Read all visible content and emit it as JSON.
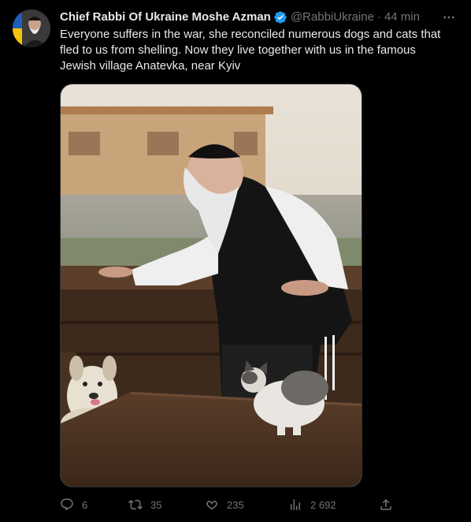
{
  "author": {
    "display_name": "Chief Rabbi Of Ukraine Moshe Azman",
    "handle": "@RabbiUkraine",
    "separator": "·",
    "time": "44 min",
    "verified": true
  },
  "tweet": {
    "text": "Everyone suffers in the war, she reconciled numerous dogs and cats that fled to us from shelling. Now they live together with us in the famous Jewish village Anatevka, near Kyiv"
  },
  "actions": {
    "replies": "6",
    "reposts": "35",
    "likes": "235",
    "views": "2 692"
  },
  "colors": {
    "background": "#000000",
    "text": "#e7e9ea",
    "muted": "#71767b",
    "verified": "#1d9bf0",
    "border": "#2f3336"
  },
  "icons": [
    "more-icon",
    "verified-icon",
    "reply-icon",
    "repost-icon",
    "like-icon",
    "views-icon",
    "share-icon"
  ]
}
